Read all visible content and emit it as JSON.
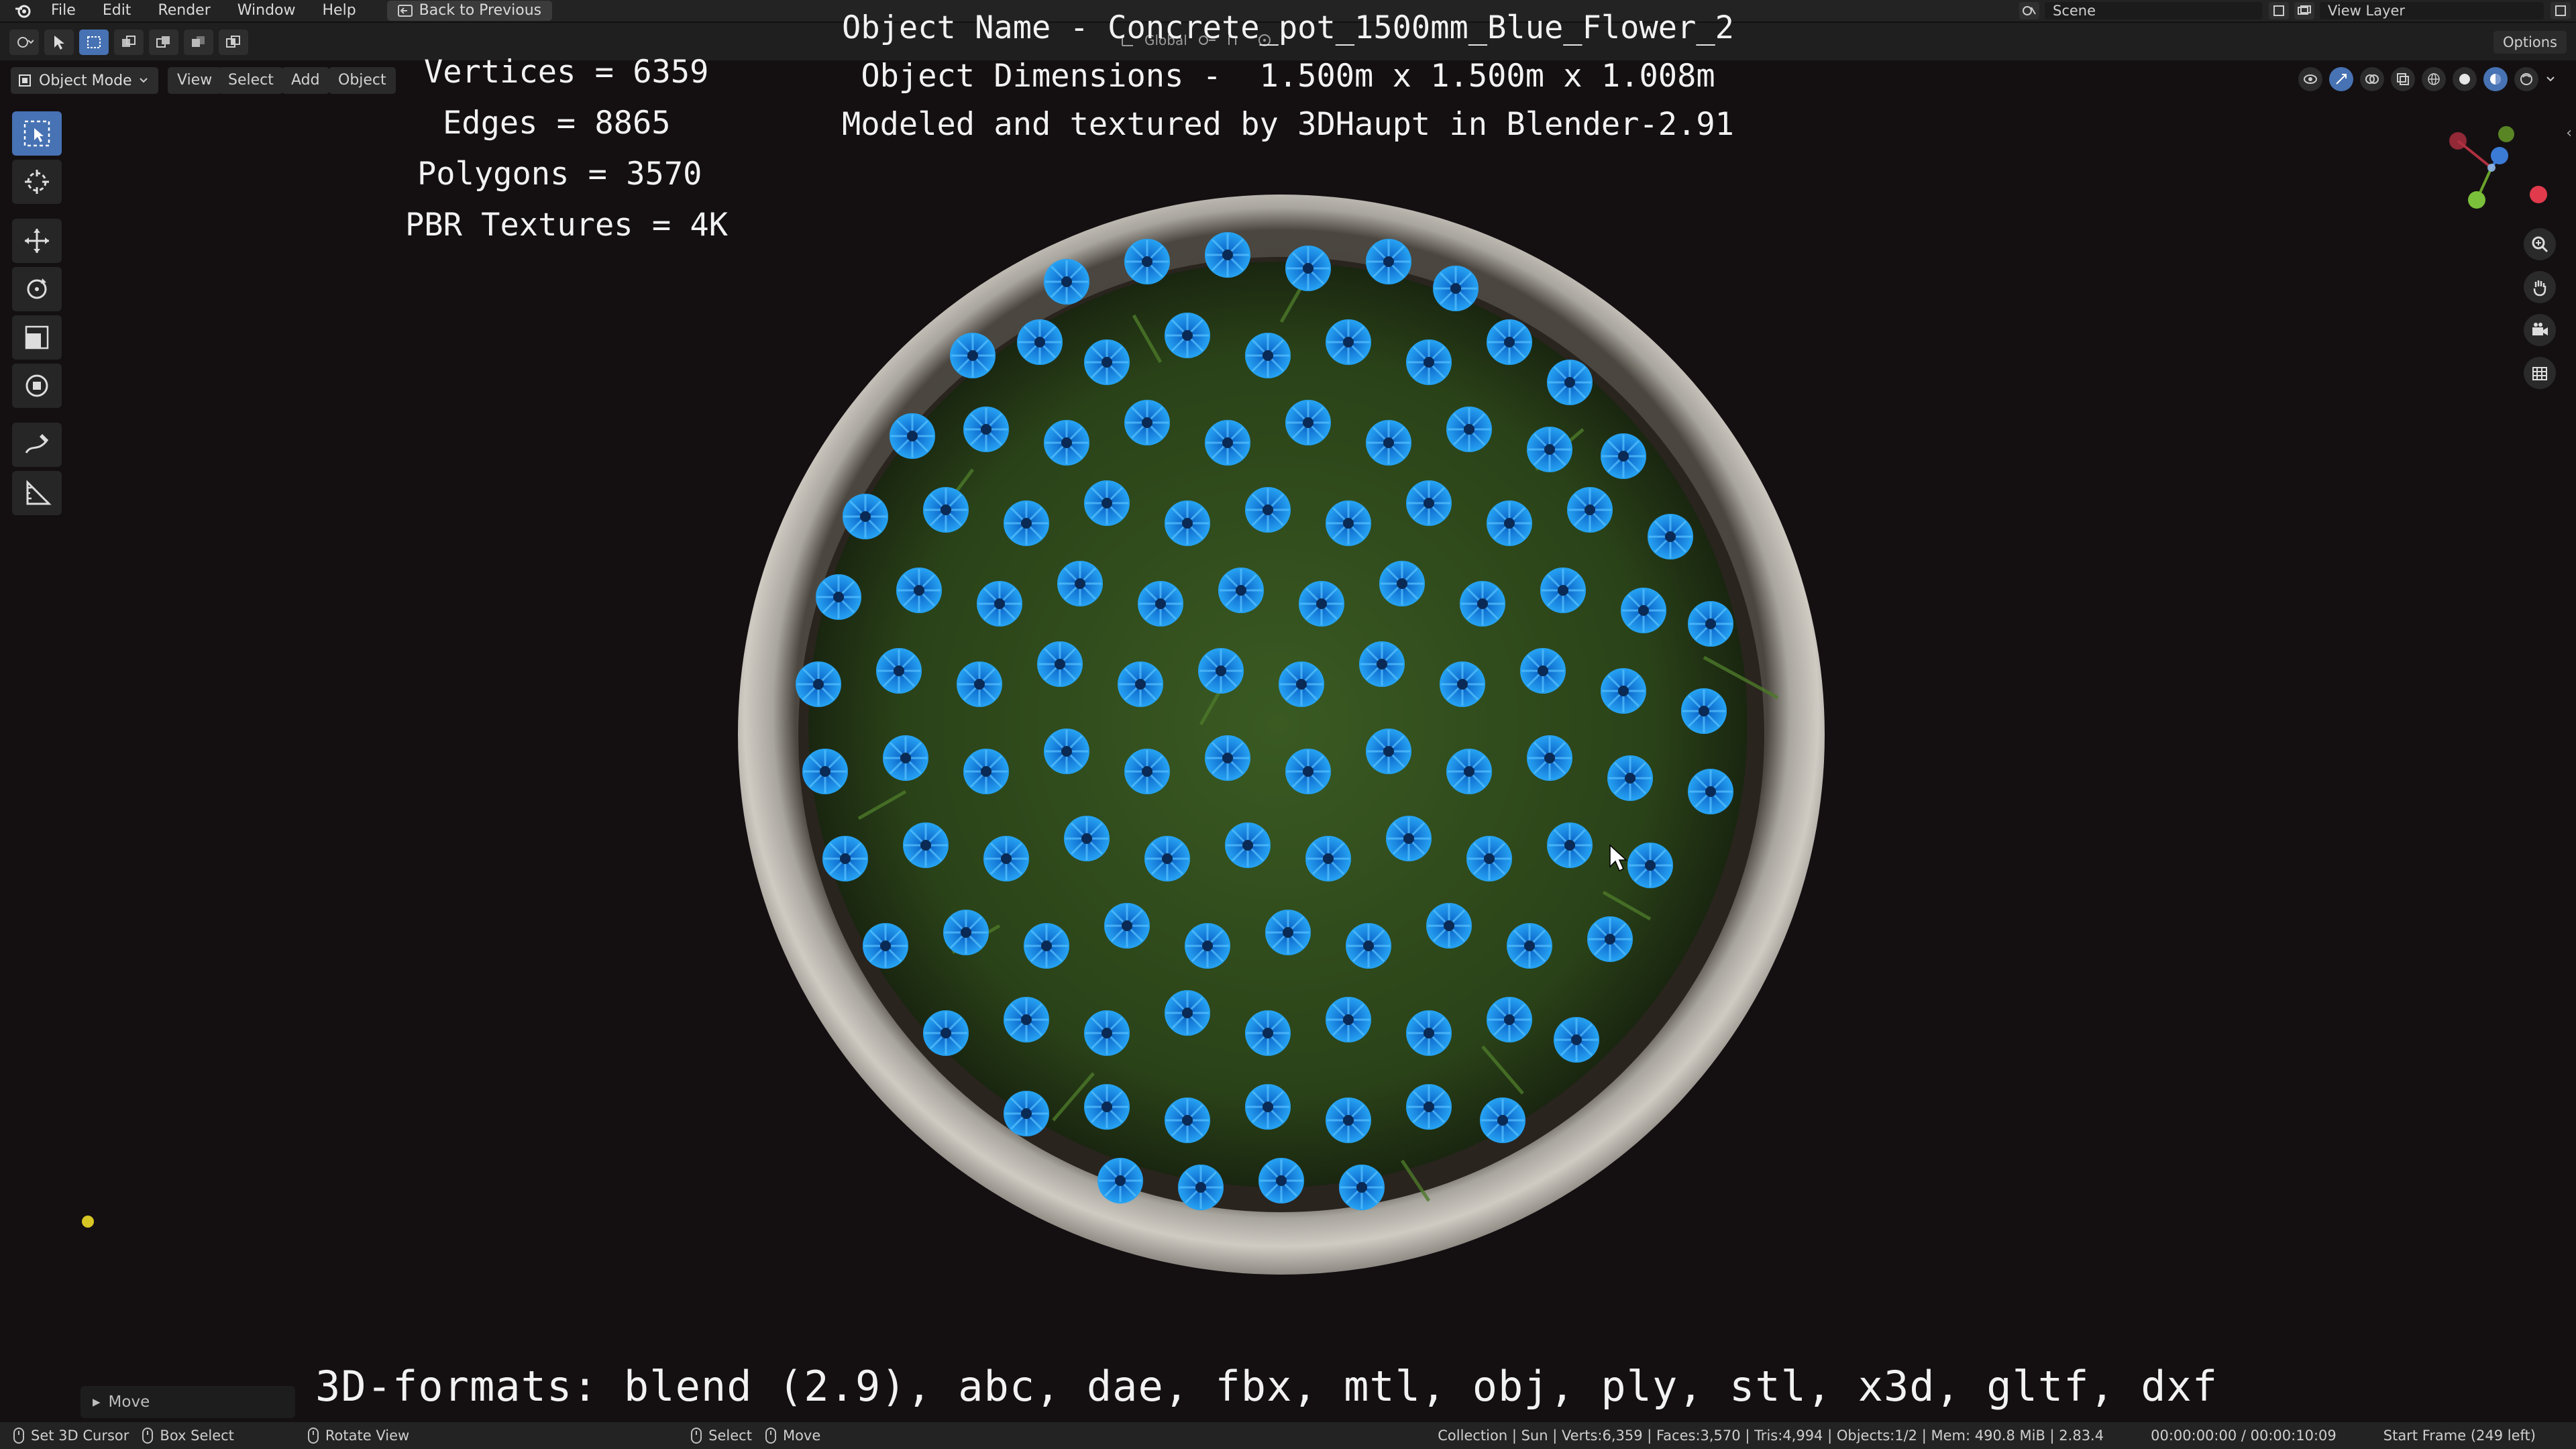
{
  "menubar": {
    "items": [
      "File",
      "Edit",
      "Render",
      "Window",
      "Help"
    ],
    "back_button": "Back to Previous",
    "scene": "Scene",
    "view_layer": "View Layer"
  },
  "toolbar": {
    "transform_orientation": "Global",
    "options": "Options"
  },
  "header": {
    "mode": "Object Mode",
    "menus": [
      "View",
      "Select",
      "Add",
      "Object"
    ]
  },
  "overlay": {
    "stats": {
      "vertices": "Vertices = 6359",
      "edges": "Edges = 8865",
      "polygons": "Polygons = 3570",
      "textures": "PBR Textures = 4K"
    },
    "object_name": "Object Name - Concrete_pot_1500mm_Blue_Flower_2",
    "object_dimensions": "Object Dimensions -  1.500m x 1.500m x 1.008m",
    "credit": "Modeled and textured by 3DHaupt in Blender-2.91",
    "formats": "3D-formats: blend (2.9), abc, dae, fbx, mtl, obj, ply, stl, x3d, gltf, dxf"
  },
  "last_operator": "Move",
  "statusbar": {
    "hints": [
      "Set 3D Cursor",
      "Box Select",
      "Rotate View",
      "Select",
      "Move"
    ],
    "scene_stats": "Collection | Sun | Verts:6,359 | Faces:3,570 | Tris:4,994 | Objects:1/2 | Mem: 490.8 MiB | 2.83.4",
    "time": "00:00:00:00 / 00:00:10:09",
    "frame": "Start Frame (249 left)"
  },
  "colors": {
    "accent": "#4772b3",
    "flower_blue": "#1e8fe6",
    "foliage": "#2f4a1c",
    "pot": "#b9b5ad"
  }
}
